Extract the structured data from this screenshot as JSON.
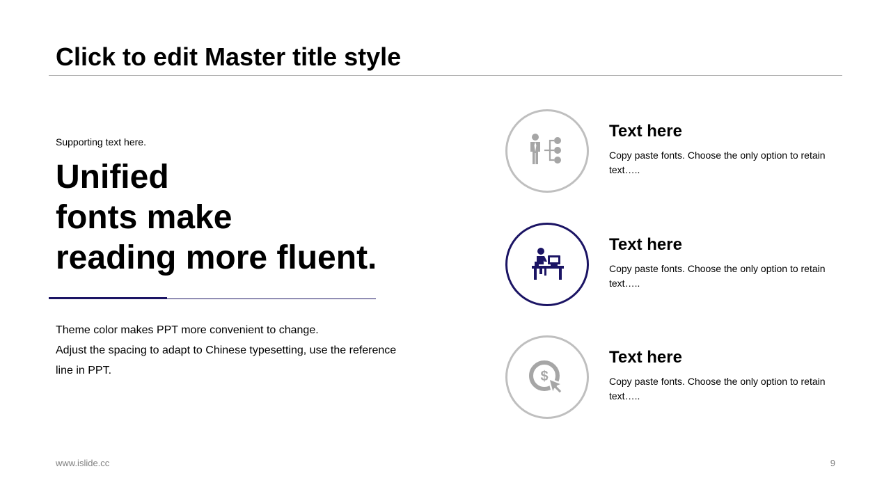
{
  "slide": {
    "title": "Click to edit Master title style",
    "supporting_text": "Supporting  text here.",
    "headline_lines": [
      "Unified",
      "fonts make",
      "reading more fluent."
    ],
    "body_lines": [
      "Theme color makes PPT more convenient to change.",
      "Adjust the spacing to adapt to Chinese typesetting, use the reference line in PPT."
    ],
    "items": [
      {
        "icon": "org-person-icon",
        "title": "Text here",
        "description": "Copy paste fonts. Choose the only option to retain text….."
      },
      {
        "icon": "desk-worker-icon",
        "title": "Text here",
        "description": "Copy paste fonts. Choose the only option to retain text….."
      },
      {
        "icon": "dollar-click-icon",
        "title": "Text here",
        "description": "Copy paste fonts. Choose the only option to retain text….."
      }
    ]
  },
  "footer": {
    "url": "www.islide.cc",
    "page_number": "9"
  },
  "colors": {
    "accent": "#1b1464",
    "muted_gray": "#a6a6a6",
    "ring_gray": "#bfbfbf",
    "rule_gray": "#b5b5b5",
    "text": "#000000",
    "footer_text": "#7f7f7f"
  }
}
